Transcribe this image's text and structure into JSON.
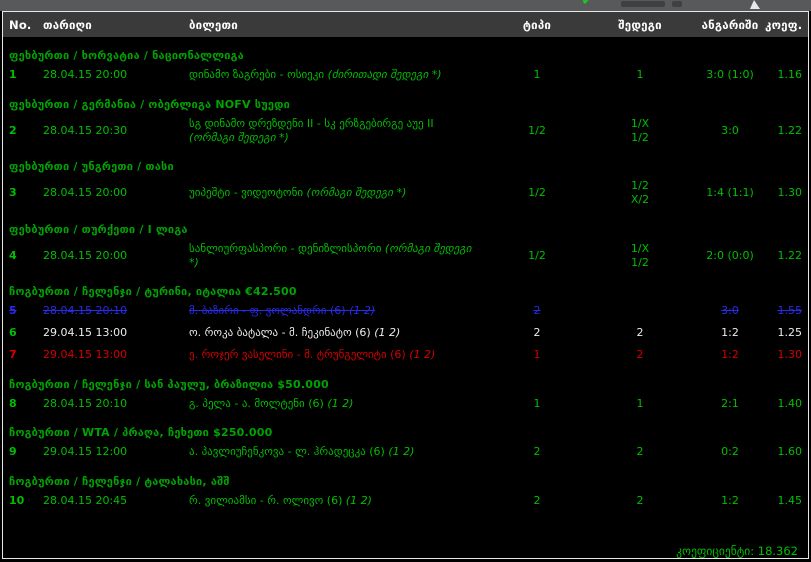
{
  "top_bar": {
    "check_icon": "green-check",
    "note": "partially-cut-off-row"
  },
  "table": {
    "columns": {
      "no": "No.",
      "date": "თარიღი",
      "ticket": "ბილეთი",
      "type": "ტიპი",
      "result": "შედეგი",
      "score": "ანგარიში",
      "coef": "კოეფ."
    },
    "sections": [
      {
        "title": "ფეხბურთი / ხორვატია / ნაციონალლიგა",
        "rows": [
          {
            "no": "1",
            "date": "28.04.15 20:00",
            "match": "დინამო ზაგრები - ოსიეკი",
            "note": "(ძირითადი შედეგი *)",
            "type": "1",
            "result": "1",
            "result2": "",
            "score": "3:0 (1:0)",
            "coef": "1.16",
            "status": "won"
          }
        ]
      },
      {
        "title": "ფეხბურთი / გერმანია / ობერლიგა NOFV სუედი",
        "rows": [
          {
            "no": "2",
            "date": "28.04.15 20:30",
            "match": "სგ დინამო დრეზდენი II - სკ ერზგებირგე აუე II",
            "note": "(ორმაგი შედეგი *)",
            "type": "1/2",
            "result": "1/X",
            "result2": "1/2",
            "score": "3:0",
            "coef": "1.22",
            "status": "won"
          }
        ]
      },
      {
        "title": "ფეხბურთი / უნგრეთი / თასი",
        "rows": [
          {
            "no": "3",
            "date": "28.04.15 20:00",
            "match": "უიპეშტი - ვიდეოტონი",
            "note": "(ორმაგი შედეგი *)",
            "type": "1/2",
            "result": "1/2",
            "result2": "X/2",
            "score": "1:4 (1:1)",
            "coef": "1.30",
            "status": "won"
          }
        ]
      },
      {
        "title": "ფეხბურთი / თურქეთი / I ლიგა",
        "rows": [
          {
            "no": "4",
            "date": "28.04.15 20:00",
            "match": "სანლიურფასპორი - დენიზლისპორი",
            "note": "(ორმაგი შედეგი *)",
            "type": "1/2",
            "result": "1/X",
            "result2": "1/2",
            "score": "2:0 (0:0)",
            "coef": "1.22",
            "status": "won"
          }
        ]
      },
      {
        "title": "ჩოგბურთი / ჩელენჯი / ტურინი, იტალია €42.500",
        "rows": [
          {
            "no": "5",
            "date": "28.04.15 20:10",
            "match": "მ. ბაზირი - ფ. ვოლანდრი (6)",
            "note": "(1 2)",
            "type": "2",
            "result": "",
            "result2": "",
            "score": "3:0",
            "coef": "1.55",
            "status": "void"
          },
          {
            "no": "6",
            "date": "29.04.15 13:00",
            "match": "ო. როკა ბატალა - მ. ჩეკინატო (6)",
            "note": "(1 2)",
            "type": "2",
            "result": "2",
            "result2": "",
            "score": "1:2",
            "coef": "1.25",
            "status": "pending"
          },
          {
            "no": "7",
            "date": "29.04.15 13:00",
            "match": "ე. როჯერ ვასელინი - მ. ტრუნგელიტი (6)",
            "note": "(1 2)",
            "type": "1",
            "result": "2",
            "result2": "",
            "score": "1:2",
            "coef": "1.30",
            "status": "lost"
          }
        ]
      },
      {
        "title": "ჩოგბურთი / ჩელენჯი / სან პაულუ, ბრაზილია $50.000",
        "rows": [
          {
            "no": "8",
            "date": "28.04.15 20:10",
            "match": "გ. პელა - ა. მოლტენი (6)",
            "note": "(1 2)",
            "type": "1",
            "result": "1",
            "result2": "",
            "score": "2:1",
            "coef": "1.40",
            "status": "won"
          }
        ]
      },
      {
        "title": "ჩოგბურთი / WTA / პრაღა, ჩეხეთი $250.000",
        "rows": [
          {
            "no": "9",
            "date": "29.04.15 12:00",
            "match": "ა. პავლიუჩენკოვა - ლ. ჰრადეცკა (6)",
            "note": "(1 2)",
            "type": "2",
            "result": "2",
            "result2": "",
            "score": "0:2",
            "coef": "1.60",
            "status": "won"
          }
        ]
      },
      {
        "title": "ჩოგბურთი / ჩელენჯი / ტალახასი, აშშ",
        "rows": [
          {
            "no": "10",
            "date": "28.04.15 20:45",
            "match": "რ. ვილიამსი - რ. ოლივო (6)",
            "note": "(1 2)",
            "type": "2",
            "result": "2",
            "result2": "",
            "score": "1:2",
            "coef": "1.45",
            "status": "won"
          }
        ]
      }
    ],
    "footer": {
      "label": "კოეფიციენტი:",
      "value": "18.362"
    }
  },
  "colors": {
    "won": "#00bf00",
    "pending": "#ececec",
    "lost": "#d40000",
    "void": "#2a2ae8",
    "section_title": "#00a302",
    "header_bg": "#3a3a3a",
    "chrome": "#58595b"
  }
}
